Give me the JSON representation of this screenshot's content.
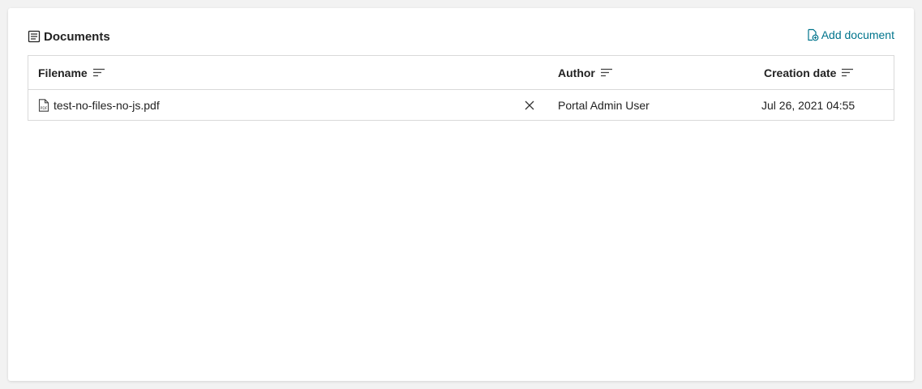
{
  "documents": {
    "title": "Documents",
    "title_icon": "document-list-icon",
    "add_label": "Add document",
    "add_icon": "add-document-icon",
    "accent_color": "#00748c",
    "columns": [
      {
        "label": "Filename",
        "sort_icon": "sort-icon"
      },
      {
        "label": "Author",
        "sort_icon": "sort-icon"
      },
      {
        "label": "Creation date",
        "sort_icon": "sort-icon"
      }
    ],
    "rows": [
      {
        "filename": "test-no-files-no-js.pdf",
        "file_icon": "pdf-file-icon",
        "remove_icon": "close-icon",
        "author": "Portal Admin User",
        "creation_date": "Jul 26, 2021 04:55"
      }
    ]
  }
}
